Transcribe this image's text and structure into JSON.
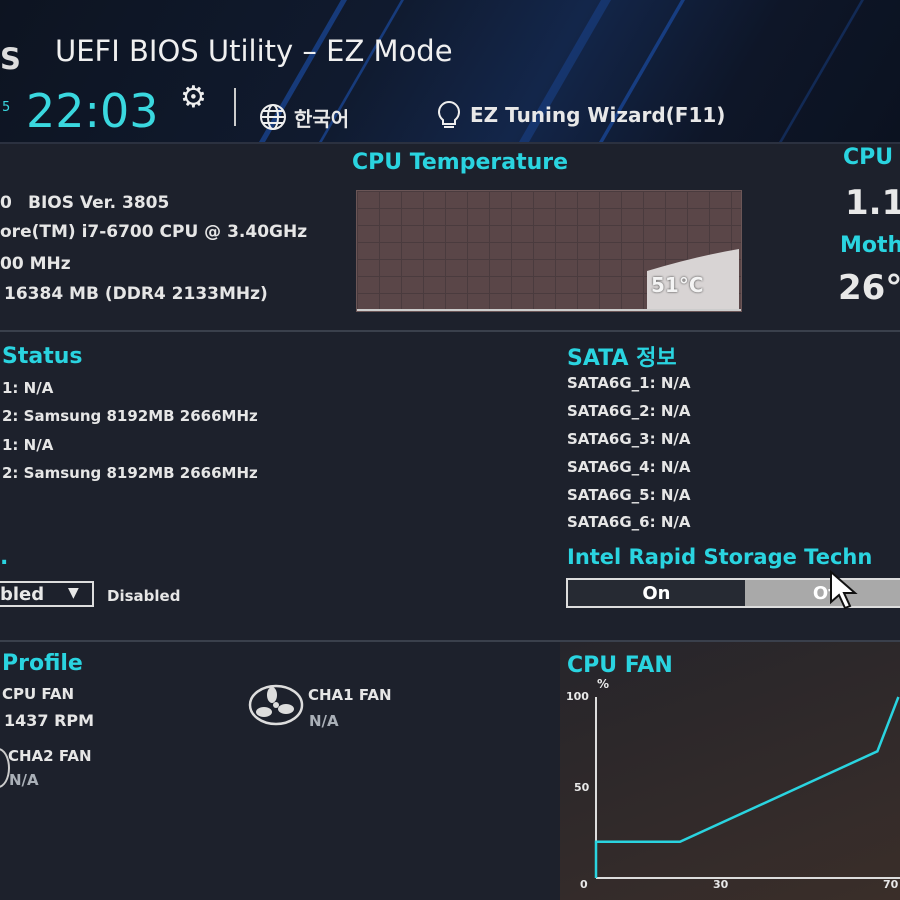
{
  "header": {
    "logo_fragment": "S",
    "title": "UEFI BIOS Utility – EZ Mode",
    "date_fragment": "5",
    "time": "22:03",
    "language": "한국어",
    "tuning_wizard": "EZ Tuning Wizard(F11)"
  },
  "info": {
    "bios_prefix": "0",
    "bios_version": "BIOS Ver. 3805",
    "cpu": "ore(TM) i7-6700 CPU @ 3.40GHz",
    "speed": "00 MHz",
    "memory": "16384 MB (DDR4 2133MHz)"
  },
  "cpu_temperature": {
    "title": "CPU Temperature",
    "value": "51°C"
  },
  "right_panel": {
    "cpu_label": "CPU",
    "cpu_value": "1.1",
    "mb_label": "Moth",
    "mb_value": "26°"
  },
  "dram_status": {
    "title": "Status",
    "slots": [
      "1: N/A",
      "2: Samsung 8192MB 2666MHz",
      "1: N/A",
      "2: Samsung 8192MB 2666MHz"
    ]
  },
  "sata": {
    "title": "SATA 정보",
    "ports": [
      "SATA6G_1: N/A",
      "SATA6G_2: N/A",
      "SATA6G_3: N/A",
      "SATA6G_4: N/A",
      "SATA6G_5: N/A",
      "SATA6G_6: N/A"
    ]
  },
  "xmp": {
    "title": ".",
    "select_value": "bled",
    "status": "Disabled"
  },
  "irst": {
    "title": "Intel Rapid Storage Techn",
    "on_label": "On",
    "off_label": "Of"
  },
  "fan_profile": {
    "title": "Profile",
    "fans": [
      {
        "name": "CPU FAN",
        "value": "1437 RPM"
      },
      {
        "name": "CHA1 FAN",
        "value": "N/A"
      },
      {
        "name": "CHA2 FAN",
        "value": "N/A"
      }
    ]
  },
  "chart_data": {
    "type": "line",
    "title": "CPU FAN",
    "ylabel": "%",
    "xlabel": "",
    "x_ticks": [
      "0",
      "30",
      "70"
    ],
    "y_ticks": [
      "0",
      "50",
      "100"
    ],
    "xlim": [
      0,
      72
    ],
    "ylim": [
      0,
      100
    ],
    "series": [
      {
        "points": [
          [
            0,
            0
          ],
          [
            0,
            20
          ],
          [
            20,
            20
          ],
          [
            67,
            70
          ],
          [
            72,
            100
          ]
        ]
      }
    ],
    "line_color": "#2ad4e0",
    "grid": false
  }
}
